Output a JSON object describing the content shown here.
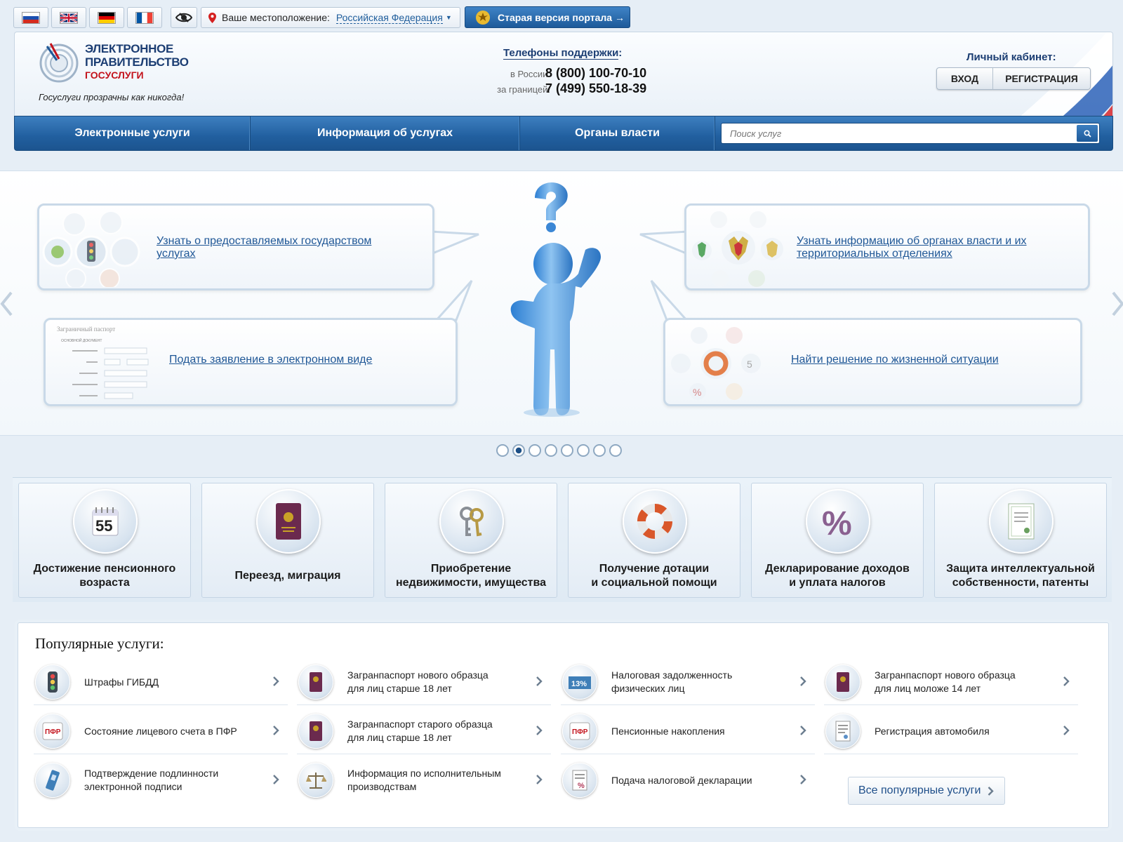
{
  "topbar": {
    "languages": [
      "ru",
      "en",
      "de",
      "fr"
    ],
    "location_label": "Ваше местоположение:",
    "location_value": "Российская Федерация",
    "old_version_label": "Старая версия портала →"
  },
  "header": {
    "logo_line1": "ЭЛЕКТРОННОЕ",
    "logo_line2": "ПРАВИТЕЛЬСТВО",
    "logo_line3": "ГОСУСЛУГИ",
    "slogan": "Госуслуги прозрачны как никогда!",
    "support": {
      "title": "Телефоны поддержки",
      "colon": ":",
      "russia_label": "в России:",
      "russia_number": "8 (800) 100-70-10",
      "abroad_label": "за границей:",
      "abroad_number": "7 (499) 550-18-39"
    },
    "cabinet": {
      "title": "Личный кабинет:",
      "login": "ВХОД",
      "register": "РЕГИСТРАЦИЯ"
    }
  },
  "nav": {
    "items": [
      "Электронные услуги",
      "Информация об услугах",
      "Органы власти"
    ],
    "search_placeholder": "Поиск услуг"
  },
  "banner": {
    "bubble1": "Узнать о предоставляемых государством услугах",
    "bubble2": "Узнать информацию об органах власти и их территориальных отделениях",
    "bubble3": "Подать заявление в электронном виде",
    "bubble4": "Найти решение по жизненной ситуации",
    "slide_count": 8,
    "active_slide": 2
  },
  "categories": [
    {
      "label": "Достижение пенсионного\nвозраста",
      "icon": "calendar-55-icon"
    },
    {
      "label": "Переезд, миграция",
      "icon": "passport-icon"
    },
    {
      "label": "Приобретение\nнедвижимости, имущества",
      "icon": "keys-icon"
    },
    {
      "label": "Получение дотации\nи социальной помощи",
      "icon": "lifebuoy-icon"
    },
    {
      "label": "Декларирование доходов\nи уплата налогов",
      "icon": "percent-icon"
    },
    {
      "label": "Защита интеллектуальной\nсобственности, патенты",
      "icon": "certificate-icon"
    }
  ],
  "popular": {
    "title": "Популярные услуги:",
    "items": [
      {
        "label": "Штрафы ГИБДД",
        "icon": "traffic-light-icon"
      },
      {
        "label": "Загранпаспорт нового образца\nдля лиц старше 18 лет",
        "icon": "passport-icon"
      },
      {
        "label": "Налоговая задолженность\nфизических лиц",
        "icon": "tax-13-icon"
      },
      {
        "label": "Загранпаспорт нового образца\nдля лиц моложе 14 лет",
        "icon": "passport-icon"
      },
      {
        "label": "Состояние лицевого счета в ПФР",
        "icon": "pfr-icon"
      },
      {
        "label": "Загранпаспорт старого образца\nдля лиц старше 18 лет",
        "icon": "passport-icon"
      },
      {
        "label": "Пенсионные накопления",
        "icon": "pfr-icon"
      },
      {
        "label": "Регистрация автомобиля",
        "icon": "document-icon"
      },
      {
        "label": "Подтверждение подлинности\nэлектронной подписи",
        "icon": "digital-signature-icon"
      },
      {
        "label": "Информация по исполнительным\nпроизводствам",
        "icon": "scales-icon"
      },
      {
        "label": "Подача налоговой декларации",
        "icon": "tax-declaration-icon"
      }
    ],
    "all_label": "Все популярные услуги"
  },
  "colors": {
    "brand_blue": "#215f9f",
    "link": "#1f5796",
    "accent_red": "#c3121b"
  }
}
